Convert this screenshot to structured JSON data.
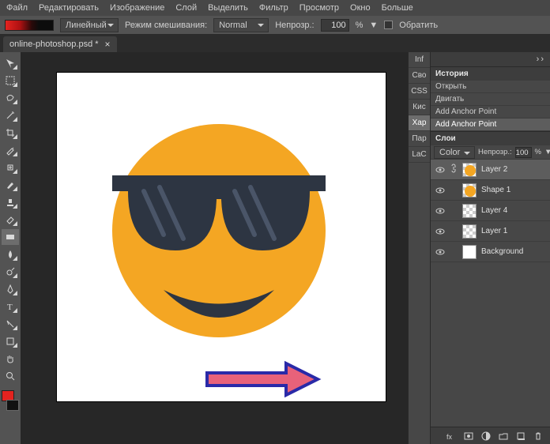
{
  "menu": [
    "Файл",
    "Редактировать",
    "Изображение",
    "Слой",
    "Выделить",
    "Фильтр",
    "Просмотр",
    "Окно",
    "Больше"
  ],
  "options": {
    "lineType": "Линейный",
    "blendLabel": "Режим смешивания:",
    "blendMode": "Normal",
    "opacityLabel": "Непрозр.:",
    "opacityValue": "100",
    "opacityPct": "%",
    "reverse": "Обратить"
  },
  "docTab": {
    "title": "online-photoshop.psd *"
  },
  "sideTabs": [
    "Inf",
    "Сво",
    "CSS",
    "Кис",
    "Хар",
    "Пар",
    "LaС"
  ],
  "sideTabActiveIndex": 4,
  "panel": {
    "historyTitle": "История",
    "history": [
      "Открыть",
      "Двигать",
      "Add Anchor Point",
      "Add Anchor Point"
    ],
    "historySel": 3,
    "layersTitle": "Слои",
    "blendMode": "Color",
    "opacityLabel": "Непрозр.:",
    "opacityValue": "100",
    "opacityPct": "%",
    "layers": [
      {
        "name": "Layer 2",
        "thumb": "emoji",
        "vis": true,
        "link": true,
        "sel": true
      },
      {
        "name": "Shape 1",
        "thumb": "emoji",
        "vis": true,
        "link": false,
        "sel": false
      },
      {
        "name": "Layer 4",
        "thumb": "checker",
        "vis": true,
        "link": false,
        "sel": false
      },
      {
        "name": "Layer 1",
        "thumb": "checker",
        "vis": true,
        "link": false,
        "sel": false
      },
      {
        "name": "Background",
        "thumb": "white",
        "vis": true,
        "link": false,
        "sel": false
      }
    ]
  },
  "colors": {
    "accent": "#f4a623",
    "glasses": "#2d3542",
    "arrowFill": "#e8627a",
    "arrowStroke": "#2a2aa8"
  }
}
